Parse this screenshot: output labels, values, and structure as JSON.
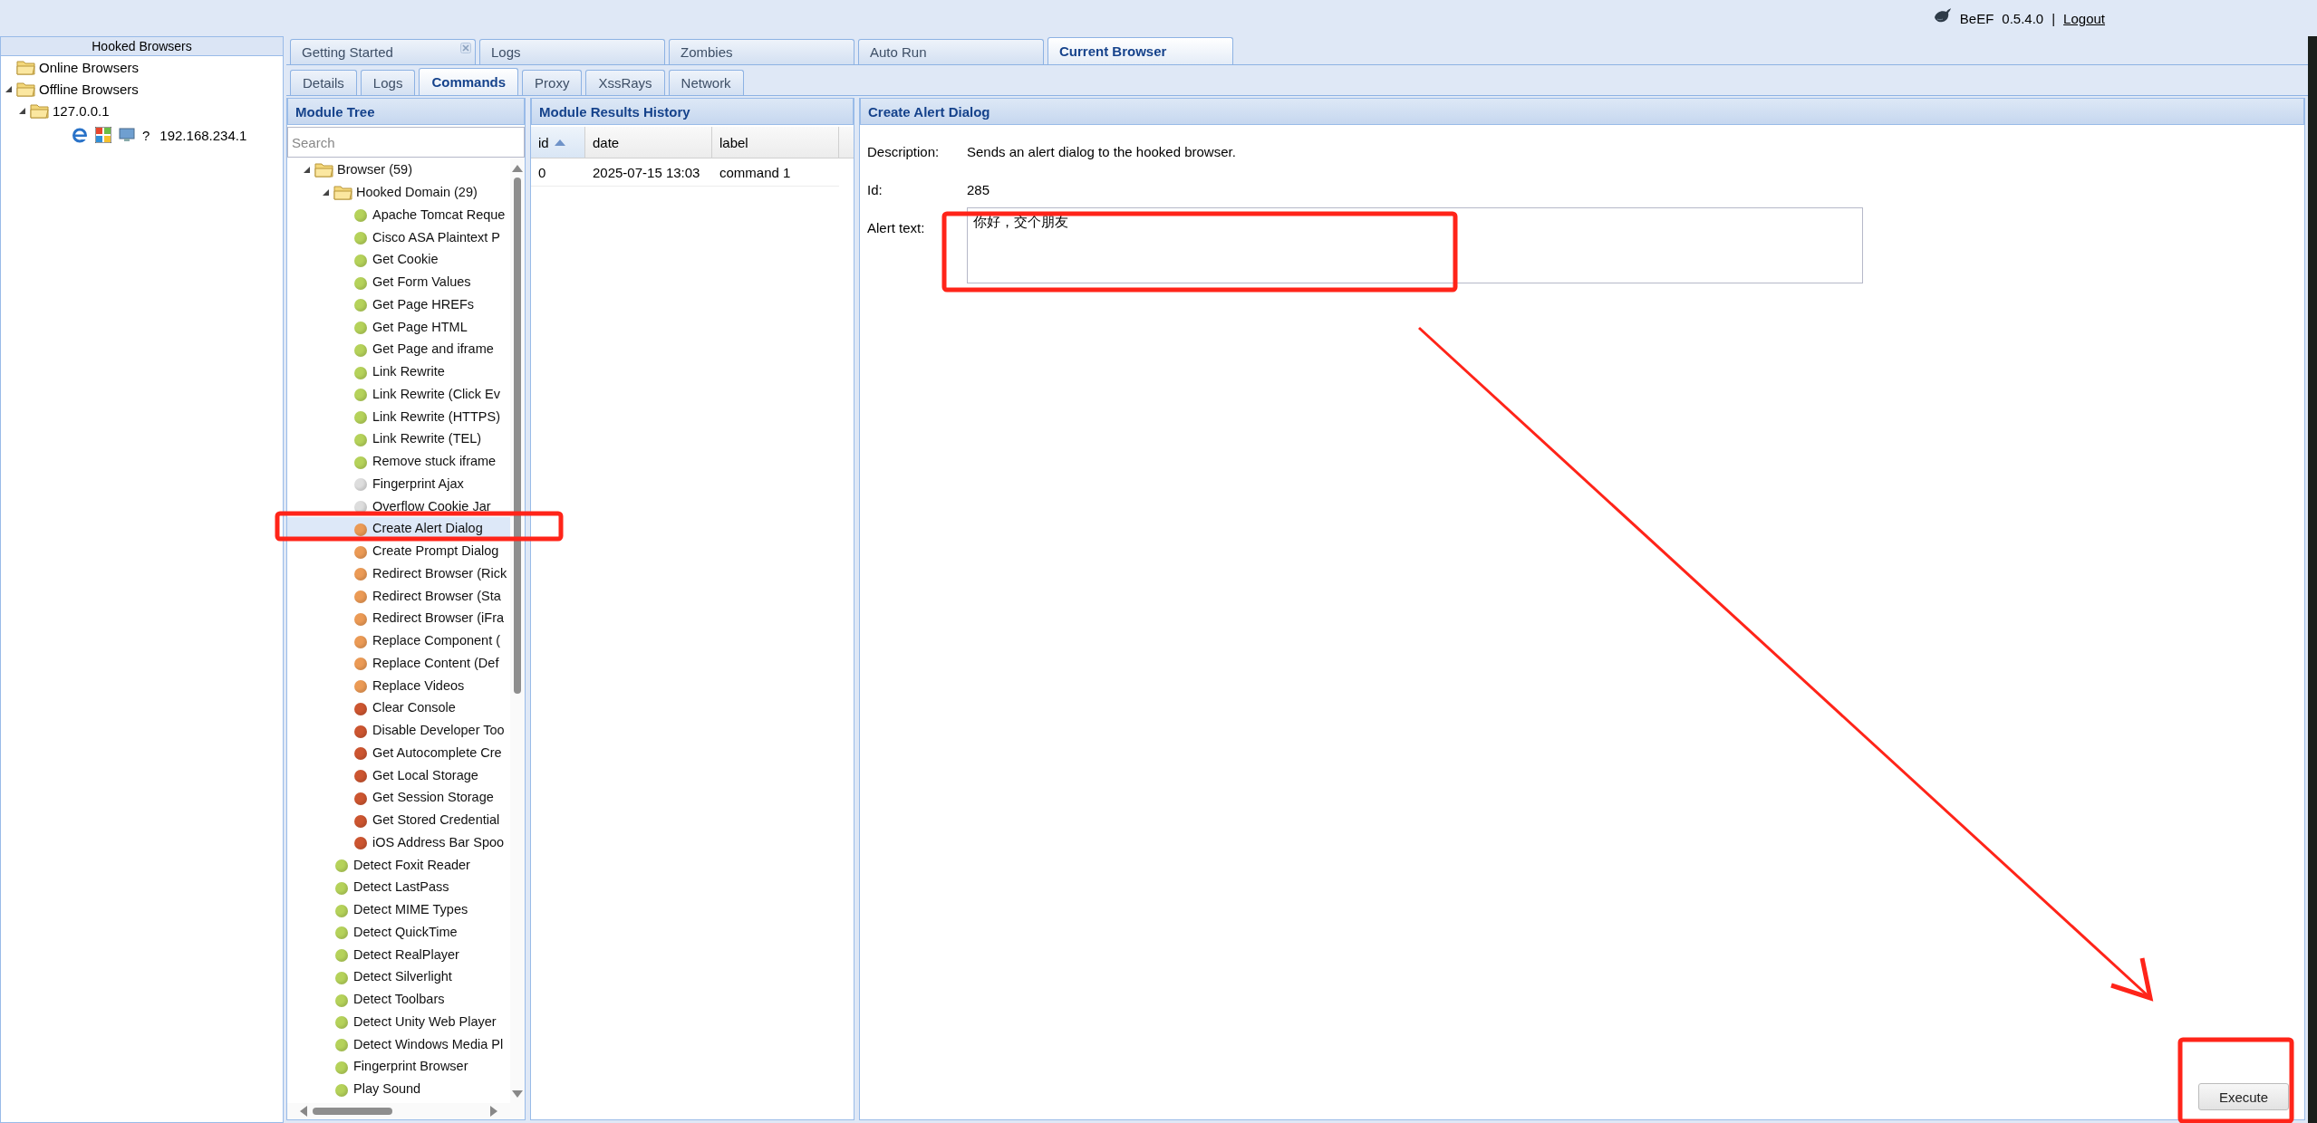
{
  "header": {
    "app_name": "BeEF",
    "version": "0.5.4.0",
    "separator": "|",
    "logout": "Logout"
  },
  "hooked_browsers": {
    "title": "Hooked Browsers",
    "tree": [
      {
        "label": "Online Browsers",
        "selected": false
      },
      {
        "label": "Offline Browsers",
        "selected": false,
        "expanded": true,
        "children": [
          {
            "label": "127.0.0.1",
            "selected": false,
            "expanded": true,
            "children": [
              {
                "label": "192.168.234.1",
                "selected": false,
                "glyph": "?"
              }
            ]
          }
        ]
      }
    ]
  },
  "main_tabs": [
    {
      "label": "Getting Started",
      "selected": false,
      "closable": true
    },
    {
      "label": "Logs",
      "selected": false,
      "closable": false
    },
    {
      "label": "Zombies",
      "selected": false,
      "closable": false
    },
    {
      "label": "Auto Run",
      "selected": false,
      "closable": false
    },
    {
      "label": "Current Browser",
      "selected": true,
      "closable": false
    }
  ],
  "sub_tabs": [
    {
      "label": "Details",
      "selected": false
    },
    {
      "label": "Logs",
      "selected": false
    },
    {
      "label": "Commands",
      "selected": true
    },
    {
      "label": "Proxy",
      "selected": false
    },
    {
      "label": "XssRays",
      "selected": false
    },
    {
      "label": "Network",
      "selected": false
    }
  ],
  "module_tree": {
    "title": "Module Tree",
    "search_placeholder": "Search",
    "items": [
      {
        "label": "Browser (59)",
        "selected": false,
        "expanded": true,
        "children": [
          {
            "label": "Hooked Domain (29)",
            "selected": false,
            "expanded": true,
            "children": [
              {
                "label": "Apache Tomcat Reque",
                "color": "#b5d25a",
                "selected": false
              },
              {
                "label": "Cisco ASA Plaintext P",
                "color": "#b5d25a",
                "selected": false
              },
              {
                "label": "Get Cookie",
                "color": "#b5d25a",
                "selected": false
              },
              {
                "label": "Get Form Values",
                "color": "#b5d25a",
                "selected": false
              },
              {
                "label": "Get Page HREFs",
                "color": "#b5d25a",
                "selected": false
              },
              {
                "label": "Get Page HTML",
                "color": "#b5d25a",
                "selected": false
              },
              {
                "label": "Get Page and iframe",
                "color": "#b5d25a",
                "selected": false
              },
              {
                "label": "Link Rewrite",
                "color": "#b5d25a",
                "selected": false
              },
              {
                "label": "Link Rewrite (Click Ev",
                "color": "#b5d25a",
                "selected": false
              },
              {
                "label": "Link Rewrite (HTTPS)",
                "color": "#b5d25a",
                "selected": false
              },
              {
                "label": "Link Rewrite (TEL)",
                "color": "#b5d25a",
                "selected": false
              },
              {
                "label": "Remove stuck iframe",
                "color": "#b5d25a",
                "selected": false
              },
              {
                "label": "Fingerprint Ajax",
                "color": "#dddddd",
                "selected": false
              },
              {
                "label": "Overflow Cookie Jar",
                "color": "#dddddd",
                "selected": false
              },
              {
                "label": "Create Alert Dialog",
                "color": "#eb9a55",
                "selected": true
              },
              {
                "label": "Create Prompt Dialog",
                "color": "#eb9a55",
                "selected": false
              },
              {
                "label": "Redirect Browser (Rick",
                "color": "#eb9a55",
                "selected": false
              },
              {
                "label": "Redirect Browser (Sta",
                "color": "#eb9a55",
                "selected": false
              },
              {
                "label": "Redirect Browser (iFra",
                "color": "#eb9a55",
                "selected": false
              },
              {
                "label": "Replace Component (",
                "color": "#eb9a55",
                "selected": false
              },
              {
                "label": "Replace Content (Def",
                "color": "#eb9a55",
                "selected": false
              },
              {
                "label": "Replace Videos",
                "color": "#eb9a55",
                "selected": false
              },
              {
                "label": "Clear Console",
                "color": "#cc5530",
                "selected": false
              },
              {
                "label": "Disable Developer Too",
                "color": "#cc5530",
                "selected": false
              },
              {
                "label": "Get Autocomplete Cre",
                "color": "#cc5530",
                "selected": false
              },
              {
                "label": "Get Local Storage",
                "color": "#cc5530",
                "selected": false
              },
              {
                "label": "Get Session Storage",
                "color": "#cc5530",
                "selected": false
              },
              {
                "label": "Get Stored Credential",
                "color": "#cc5530",
                "selected": false
              },
              {
                "label": "iOS Address Bar Spoo",
                "color": "#cc5530",
                "selected": false
              }
            ]
          },
          {
            "label": "Detect Foxit Reader",
            "color": "#b5d25a",
            "selected": false
          },
          {
            "label": "Detect LastPass",
            "color": "#b5d25a",
            "selected": false
          },
          {
            "label": "Detect MIME Types",
            "color": "#b5d25a",
            "selected": false
          },
          {
            "label": "Detect QuickTime",
            "color": "#b5d25a",
            "selected": false
          },
          {
            "label": "Detect RealPlayer",
            "color": "#b5d25a",
            "selected": false
          },
          {
            "label": "Detect Silverlight",
            "color": "#b5d25a",
            "selected": false
          },
          {
            "label": "Detect Toolbars",
            "color": "#b5d25a",
            "selected": false
          },
          {
            "label": "Detect Unity Web Player",
            "color": "#b5d25a",
            "selected": false
          },
          {
            "label": "Detect Windows Media Pl",
            "color": "#b5d25a",
            "selected": false
          },
          {
            "label": "Fingerprint Browser",
            "color": "#b5d25a",
            "selected": false
          },
          {
            "label": "Play Sound",
            "color": "#b5d25a",
            "selected": false
          }
        ]
      }
    ]
  },
  "results": {
    "title": "Module Results History",
    "columns": [
      {
        "label": "id",
        "sorted": true
      },
      {
        "label": "date",
        "sorted": false
      },
      {
        "label": "label",
        "sorted": false
      }
    ],
    "rows": [
      [
        "0",
        "2025-07-15 13:03",
        "command 1"
      ]
    ]
  },
  "module": {
    "title": "Create Alert Dialog",
    "fields": [
      {
        "kind": "text",
        "label": "Description:",
        "value": "Sends an alert dialog to the hooked browser."
      },
      {
        "kind": "text",
        "label": "Id:",
        "value": "285"
      },
      {
        "kind": "textarea",
        "label": "Alert text:",
        "value": "你好，交个朋友"
      }
    ],
    "execute": "Execute"
  }
}
